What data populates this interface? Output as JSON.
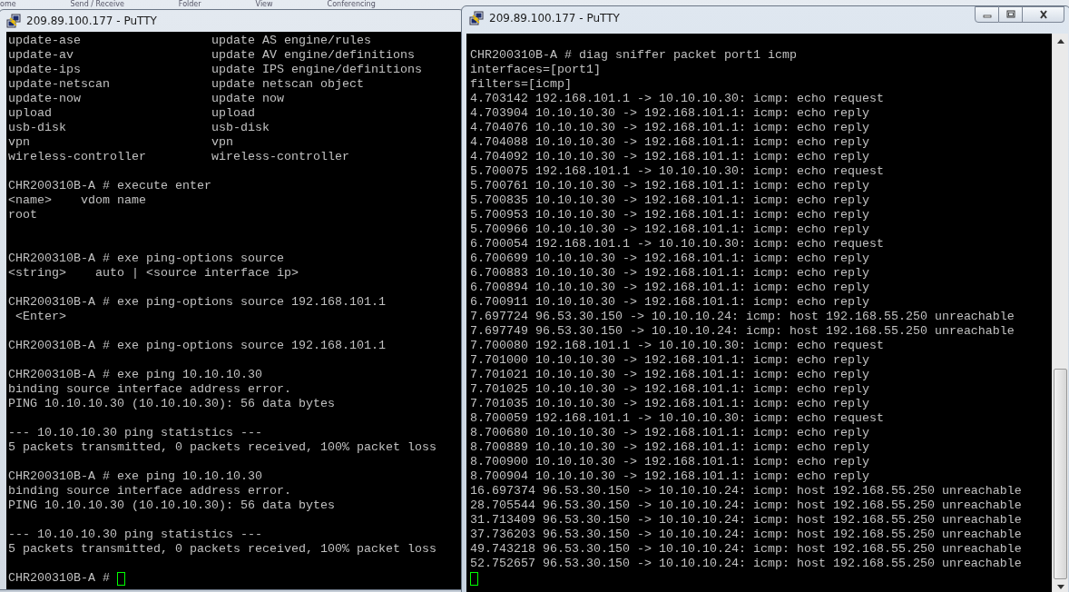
{
  "background_ribbon": [
    "ome",
    "Send / Receive",
    "Folder",
    "View",
    "Conferencing"
  ],
  "windows": [
    {
      "title": "209.89.100.177 - PuTTY",
      "active": false,
      "scrollbar": false,
      "lines": [
        {
          "kind": "text",
          "text": "update-ase                  update AS engine/rules"
        },
        {
          "kind": "text",
          "text": "update-av                   update AV engine/definitions"
        },
        {
          "kind": "text",
          "text": "update-ips                  update IPS engine/definitions"
        },
        {
          "kind": "text",
          "text": "update-netscan              update netscan object"
        },
        {
          "kind": "text",
          "text": "update-now                  update now"
        },
        {
          "kind": "text",
          "text": "upload                      upload"
        },
        {
          "kind": "text",
          "text": "usb-disk                    usb-disk"
        },
        {
          "kind": "text",
          "text": "vpn                         vpn"
        },
        {
          "kind": "text",
          "text": "wireless-controller         wireless-controller"
        },
        {
          "kind": "blank"
        },
        {
          "kind": "text",
          "text": "CHR200310B-A # execute enter"
        },
        {
          "kind": "text",
          "text": "<name>    vdom name"
        },
        {
          "kind": "text",
          "text": "root"
        },
        {
          "kind": "blank"
        },
        {
          "kind": "blank"
        },
        {
          "kind": "text",
          "text": "CHR200310B-A # exe ping-options source"
        },
        {
          "kind": "text",
          "text": "<string>    auto | <source interface ip>"
        },
        {
          "kind": "blank"
        },
        {
          "kind": "text",
          "text": "CHR200310B-A # exe ping-options source 192.168.101.1"
        },
        {
          "kind": "text",
          "text": " <Enter>"
        },
        {
          "kind": "blank"
        },
        {
          "kind": "text",
          "text": "CHR200310B-A # exe ping-options source 192.168.101.1"
        },
        {
          "kind": "blank"
        },
        {
          "kind": "text",
          "text": "CHR200310B-A # exe ping 10.10.10.30"
        },
        {
          "kind": "text",
          "text": "binding source interface address error."
        },
        {
          "kind": "text",
          "text": "PING 10.10.10.30 (10.10.10.30): 56 data bytes"
        },
        {
          "kind": "blank"
        },
        {
          "kind": "text",
          "text": "--- 10.10.10.30 ping statistics ---"
        },
        {
          "kind": "text",
          "text": "5 packets transmitted, 0 packets received, 100% packet loss"
        },
        {
          "kind": "blank"
        },
        {
          "kind": "text",
          "text": "CHR200310B-A # exe ping 10.10.10.30"
        },
        {
          "kind": "text",
          "text": "binding source interface address error."
        },
        {
          "kind": "text",
          "text": "PING 10.10.10.30 (10.10.10.30): 56 data bytes"
        },
        {
          "kind": "blank"
        },
        {
          "kind": "text",
          "text": "--- 10.10.10.30 ping statistics ---"
        },
        {
          "kind": "text",
          "text": "5 packets transmitted, 0 packets received, 100% packet loss"
        },
        {
          "kind": "blank"
        },
        {
          "kind": "prompt",
          "text": "CHR200310B-A #"
        }
      ]
    },
    {
      "title": "209.89.100.177 - PuTTY",
      "active": true,
      "scrollbar": true,
      "lines": [
        {
          "kind": "blank"
        },
        {
          "kind": "text",
          "text": "CHR200310B-A # diag sniffer packet port1 icmp"
        },
        {
          "kind": "text",
          "text": "interfaces=[port1]"
        },
        {
          "kind": "text",
          "text": "filters=[icmp]"
        },
        {
          "kind": "text",
          "text": "4.703142 192.168.101.1 -> 10.10.10.30: icmp: echo request"
        },
        {
          "kind": "text",
          "text": "4.703904 10.10.10.30 -> 192.168.101.1: icmp: echo reply"
        },
        {
          "kind": "text",
          "text": "4.704076 10.10.10.30 -> 192.168.101.1: icmp: echo reply"
        },
        {
          "kind": "text",
          "text": "4.704088 10.10.10.30 -> 192.168.101.1: icmp: echo reply"
        },
        {
          "kind": "text",
          "text": "4.704092 10.10.10.30 -> 192.168.101.1: icmp: echo reply"
        },
        {
          "kind": "text",
          "text": "5.700075 192.168.101.1 -> 10.10.10.30: icmp: echo request"
        },
        {
          "kind": "text",
          "text": "5.700761 10.10.10.30 -> 192.168.101.1: icmp: echo reply"
        },
        {
          "kind": "text",
          "text": "5.700835 10.10.10.30 -> 192.168.101.1: icmp: echo reply"
        },
        {
          "kind": "text",
          "text": "5.700953 10.10.10.30 -> 192.168.101.1: icmp: echo reply"
        },
        {
          "kind": "text",
          "text": "5.700966 10.10.10.30 -> 192.168.101.1: icmp: echo reply"
        },
        {
          "kind": "text",
          "text": "6.700054 192.168.101.1 -> 10.10.10.30: icmp: echo request"
        },
        {
          "kind": "text",
          "text": "6.700699 10.10.10.30 -> 192.168.101.1: icmp: echo reply"
        },
        {
          "kind": "text",
          "text": "6.700883 10.10.10.30 -> 192.168.101.1: icmp: echo reply"
        },
        {
          "kind": "text",
          "text": "6.700894 10.10.10.30 -> 192.168.101.1: icmp: echo reply"
        },
        {
          "kind": "text",
          "text": "6.700911 10.10.10.30 -> 192.168.101.1: icmp: echo reply"
        },
        {
          "kind": "text",
          "text": "7.697724 96.53.30.150 -> 10.10.10.24: icmp: host 192.168.55.250 unreachable"
        },
        {
          "kind": "text",
          "text": "7.697749 96.53.30.150 -> 10.10.10.24: icmp: host 192.168.55.250 unreachable"
        },
        {
          "kind": "text",
          "text": "7.700080 192.168.101.1 -> 10.10.10.30: icmp: echo request"
        },
        {
          "kind": "text",
          "text": "7.701000 10.10.10.30 -> 192.168.101.1: icmp: echo reply"
        },
        {
          "kind": "text",
          "text": "7.701021 10.10.10.30 -> 192.168.101.1: icmp: echo reply"
        },
        {
          "kind": "text",
          "text": "7.701025 10.10.10.30 -> 192.168.101.1: icmp: echo reply"
        },
        {
          "kind": "text",
          "text": "7.701035 10.10.10.30 -> 192.168.101.1: icmp: echo reply"
        },
        {
          "kind": "text",
          "text": "8.700059 192.168.101.1 -> 10.10.10.30: icmp: echo request"
        },
        {
          "kind": "text",
          "text": "8.700680 10.10.10.30 -> 192.168.101.1: icmp: echo reply"
        },
        {
          "kind": "text",
          "text": "8.700889 10.10.10.30 -> 192.168.101.1: icmp: echo reply"
        },
        {
          "kind": "text",
          "text": "8.700900 10.10.10.30 -> 192.168.101.1: icmp: echo reply"
        },
        {
          "kind": "text",
          "text": "8.700904 10.10.10.30 -> 192.168.101.1: icmp: echo reply"
        },
        {
          "kind": "text",
          "text": "16.697374 96.53.30.150 -> 10.10.10.24: icmp: host 192.168.55.250 unreachable"
        },
        {
          "kind": "text",
          "text": "28.705544 96.53.30.150 -> 10.10.10.24: icmp: host 192.168.55.250 unreachable"
        },
        {
          "kind": "text",
          "text": "31.713409 96.53.30.150 -> 10.10.10.24: icmp: host 192.168.55.250 unreachable"
        },
        {
          "kind": "text",
          "text": "37.736203 96.53.30.150 -> 10.10.10.24: icmp: host 192.168.55.250 unreachable"
        },
        {
          "kind": "text",
          "text": "49.743218 96.53.30.150 -> 10.10.10.24: icmp: host 192.168.55.250 unreachable"
        },
        {
          "kind": "text",
          "text": "52.752657 96.53.30.150 -> 10.10.10.24: icmp: host 192.168.55.250 unreachable"
        },
        {
          "kind": "prompt"
        }
      ]
    }
  ]
}
